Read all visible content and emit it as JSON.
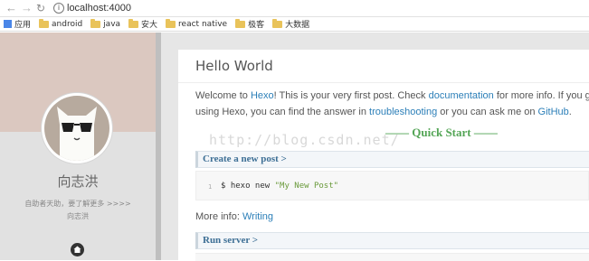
{
  "browser": {
    "url": "localhost:4000",
    "bookmarks": [
      "应用",
      "android",
      "java",
      "安大",
      "react native",
      "极客",
      "大数据"
    ]
  },
  "sidebar": {
    "author": "向志洪",
    "motto": "自助者天助，要了解更多 >>>>",
    "author_small": "向志洪"
  },
  "post": {
    "title": "Hello World",
    "p1": {
      "t1": "Welcome to ",
      "l1": "Hexo",
      "t2": "! This is your very first post. Check ",
      "l2": "documentation",
      "t3": " for more info. If you g"
    },
    "p2": {
      "t1": "using Hexo, you can find the answer in ",
      "l1": "troubleshooting",
      "t2": " or you can ask me on ",
      "l2": "GitHub",
      "t3": "."
    },
    "watermark": "http://blog.csdn.net/",
    "quick_start": "—— Quick Start ——",
    "section1": "Create a new post >",
    "code": {
      "line_no": "1",
      "cmd": "$ hexo new ",
      "arg": "\"My New Post\""
    },
    "more_info": {
      "label": "More info: ",
      "link": "Writing"
    },
    "section2": "Run server >"
  }
}
